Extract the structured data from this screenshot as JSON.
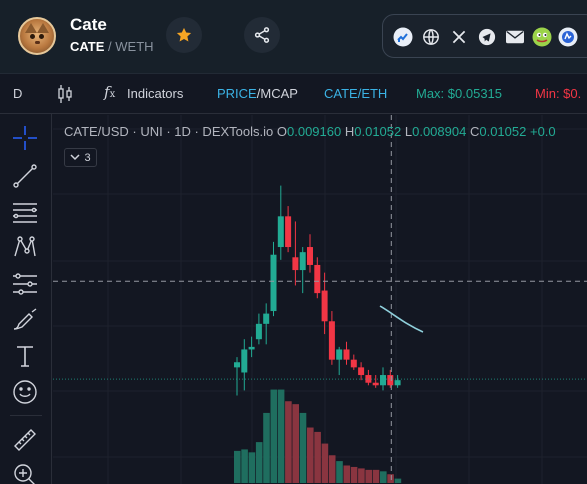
{
  "header": {
    "token_name": "Cate",
    "pair_base": "CATE",
    "pair_sep": " / ",
    "pair_quote": "WETH"
  },
  "toolbar": {
    "interval": "D",
    "indicators_label": "Indicators",
    "price_label": "PRICE",
    "mcap_sep": "/",
    "mcap_label": "MCAP",
    "pair_toggle": "CATE/ETH",
    "max_label": "Max: $0.05315",
    "min_label": "Min: $0."
  },
  "chart": {
    "symbol": "CATE/USD · UNI · 1D · DEXTools.io",
    "ohlc": {
      "o_key": "O",
      "o": "0.009160",
      "h_key": "H",
      "h": "0.01052",
      "l_key": "L",
      "l": "0.008904",
      "c_key": "C",
      "c": "0.01052",
      "chg": "+0.0"
    },
    "collapse_count": "3"
  },
  "colors": {
    "up": "#22ab94",
    "down": "#f23645",
    "vol_up": "#1f6e5f",
    "vol_down": "#8a3540",
    "price_line": "#8fd0dc"
  },
  "icons": {
    "star": "star-icon",
    "share": "share-icon",
    "socials": [
      "analytics-icon",
      "globe-icon",
      "x-icon",
      "telegram-icon",
      "email-icon",
      "pepe-icon",
      "token-icon"
    ]
  },
  "chart_data": {
    "type": "candlestick",
    "candles": [
      {
        "o": 5.9,
        "h": 6.3,
        "l": 4.8,
        "c": 6.1
      },
      {
        "o": 5.7,
        "h": 7.0,
        "l": 5.0,
        "c": 6.6
      },
      {
        "o": 6.6,
        "h": 7.1,
        "l": 6.3,
        "c": 6.7
      },
      {
        "o": 7.0,
        "h": 8.0,
        "l": 6.8,
        "c": 7.6
      },
      {
        "o": 7.6,
        "h": 8.4,
        "l": 6.8,
        "c": 8.0
      },
      {
        "o": 8.1,
        "h": 10.8,
        "l": 7.9,
        "c": 10.3
      },
      {
        "o": 10.6,
        "h": 13.0,
        "l": 10.1,
        "c": 11.8
      },
      {
        "o": 11.8,
        "h": 12.2,
        "l": 10.4,
        "c": 10.6
      },
      {
        "o": 10.2,
        "h": 11.6,
        "l": 9.1,
        "c": 9.7
      },
      {
        "o": 9.7,
        "h": 10.6,
        "l": 8.8,
        "c": 10.4
      },
      {
        "o": 10.6,
        "h": 11.1,
        "l": 9.6,
        "c": 9.9
      },
      {
        "o": 9.9,
        "h": 10.2,
        "l": 8.6,
        "c": 8.8
      },
      {
        "o": 8.9,
        "h": 9.6,
        "l": 7.2,
        "c": 7.7
      },
      {
        "o": 7.7,
        "h": 8.1,
        "l": 6.0,
        "c": 6.2
      },
      {
        "o": 6.2,
        "h": 6.7,
        "l": 5.6,
        "c": 6.6
      },
      {
        "o": 6.6,
        "h": 6.9,
        "l": 6.0,
        "c": 6.2
      },
      {
        "o": 6.2,
        "h": 6.4,
        "l": 5.8,
        "c": 5.9
      },
      {
        "o": 5.9,
        "h": 6.1,
        "l": 5.4,
        "c": 5.6
      },
      {
        "o": 5.6,
        "h": 5.8,
        "l": 5.2,
        "c": 5.3
      },
      {
        "o": 5.3,
        "h": 5.6,
        "l": 5.1,
        "c": 5.2
      },
      {
        "o": 5.2,
        "h": 5.9,
        "l": 5.0,
        "c": 5.6
      },
      {
        "o": 5.6,
        "h": 5.8,
        "l": 5.1,
        "c": 5.2
      },
      {
        "o": 5.2,
        "h": 5.6,
        "l": 5.1,
        "c": 5.4
      }
    ],
    "volumes": [
      22,
      23,
      21,
      28,
      48,
      64,
      64,
      56,
      54,
      48,
      38,
      35,
      27,
      19,
      15,
      12,
      11,
      10,
      9,
      9,
      8,
      6,
      3
    ],
    "price_range": [
      4.0,
      14.0
    ],
    "crosshair_candle": 21,
    "crosshair_price": 9.5,
    "grid": true
  }
}
